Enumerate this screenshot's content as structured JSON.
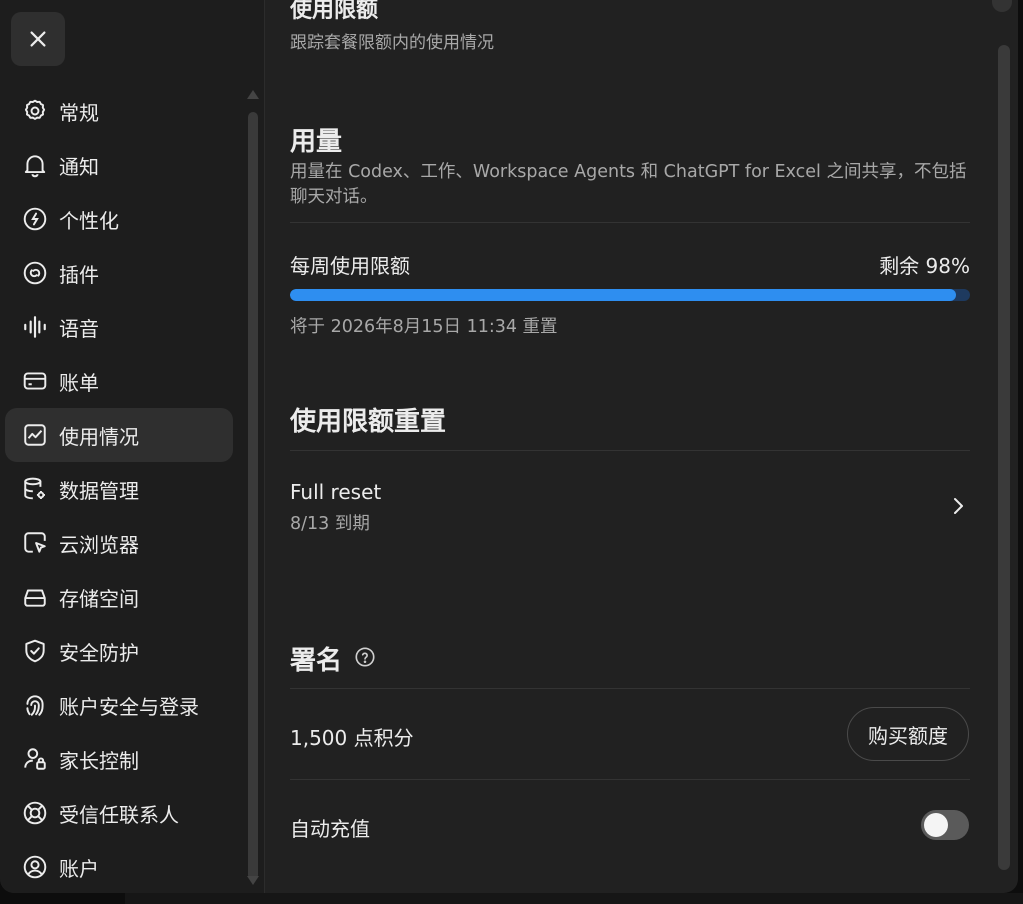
{
  "sidebar": {
    "close_icon": "close-icon",
    "items": [
      {
        "key": "general",
        "label": "常规",
        "icon": "gear-icon"
      },
      {
        "key": "notifications",
        "label": "通知",
        "icon": "bell-icon"
      },
      {
        "key": "personalization",
        "label": "个性化",
        "icon": "personalize-icon"
      },
      {
        "key": "plugins",
        "label": "插件",
        "icon": "plugin-icon"
      },
      {
        "key": "voice",
        "label": "语音",
        "icon": "waveform-icon"
      },
      {
        "key": "billing",
        "label": "账单",
        "icon": "card-icon"
      },
      {
        "key": "usage",
        "label": "使用情况",
        "icon": "chart-icon",
        "active": true
      },
      {
        "key": "data",
        "label": "数据管理",
        "icon": "database-gear-icon"
      },
      {
        "key": "cloud-browser",
        "label": "云浏览器",
        "icon": "cursor-window-icon"
      },
      {
        "key": "storage",
        "label": "存储空间",
        "icon": "storage-icon"
      },
      {
        "key": "security",
        "label": "安全防护",
        "icon": "shield-check-icon"
      },
      {
        "key": "account-security",
        "label": "账户安全与登录",
        "icon": "fingerprint-icon"
      },
      {
        "key": "parental",
        "label": "家长控制",
        "icon": "user-lock-icon"
      },
      {
        "key": "trusted-contacts",
        "label": "受信任联系人",
        "icon": "lifebuoy-icon"
      },
      {
        "key": "account",
        "label": "账户",
        "icon": "user-circle-icon"
      }
    ]
  },
  "main": {
    "top_title": "使用限额",
    "top_subtitle": "跟踪套餐限额内的使用情况",
    "usage": {
      "title": "用量",
      "description": "用量在 Codex、工作、Workspace Agents 和 ChatGPT for Excel 之间共享，不包括聊天对话。",
      "weekly_label": "每周使用限额",
      "remaining_text": "剩余 98%",
      "progress_percent": 98,
      "reset_text": "将于 2026年8月15日 11:34 重置",
      "bar_color": "#2e8ef0"
    },
    "reset": {
      "title": "使用限额重置",
      "item_title": "Full reset",
      "item_expiry": "8/13 到期"
    },
    "credits": {
      "title": "署名",
      "balance": "1,500 点积分",
      "buy_label": "购买额度",
      "auto_topup_label": "自动充值",
      "auto_topup_enabled": false
    }
  }
}
